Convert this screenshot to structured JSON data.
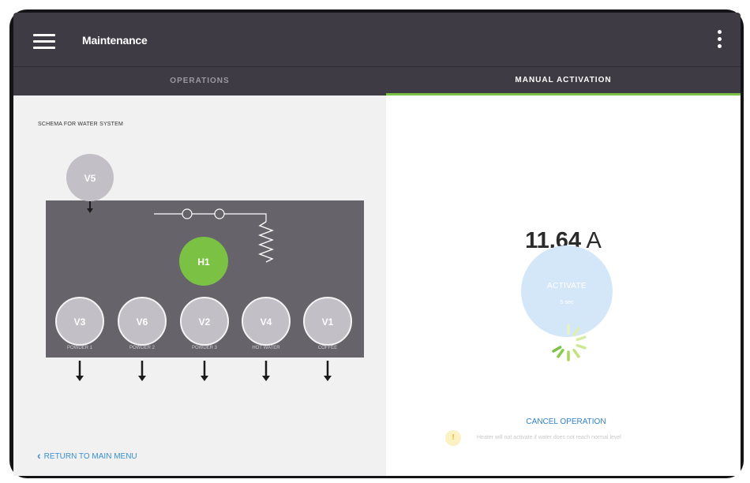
{
  "app": {
    "title": "Maintenance",
    "menu_icon": "hamburger-menu-icon",
    "more_icon": "more-vertical-icon"
  },
  "tabs": [
    {
      "label": "OPERATIONS",
      "active": false
    },
    {
      "label": "MANUAL ACTIVATION",
      "active": true
    }
  ],
  "schema": {
    "label": "SCHEMA FOR WATER SYSTEM",
    "top_valve": "V5",
    "heater": "H1",
    "valves": [
      {
        "id": "V3",
        "label": "POWDER 1"
      },
      {
        "id": "V6",
        "label": "POWDER 2"
      },
      {
        "id": "V2",
        "label": "POWDER 3"
      },
      {
        "id": "V4",
        "label": "HOT WATER"
      },
      {
        "id": "V1",
        "label": "COFFEE"
      }
    ]
  },
  "return_link": "RETURN TO MAIN MENU",
  "reading": {
    "value": "11.64",
    "unit": "A"
  },
  "activate": {
    "label": "ACTIVATE",
    "time": "5 sec"
  },
  "cancel_label": "CANCEL OPERATION",
  "warning": {
    "icon": "!",
    "text": "Heater will not activate if water does not reach normal level"
  },
  "colors": {
    "appbar": "#3f3b44",
    "tab_indicator": "#7bc143",
    "heater": "#7bc143",
    "valve": "#c2bfc7",
    "tank": "#67636b",
    "link": "#3a8fd6"
  }
}
